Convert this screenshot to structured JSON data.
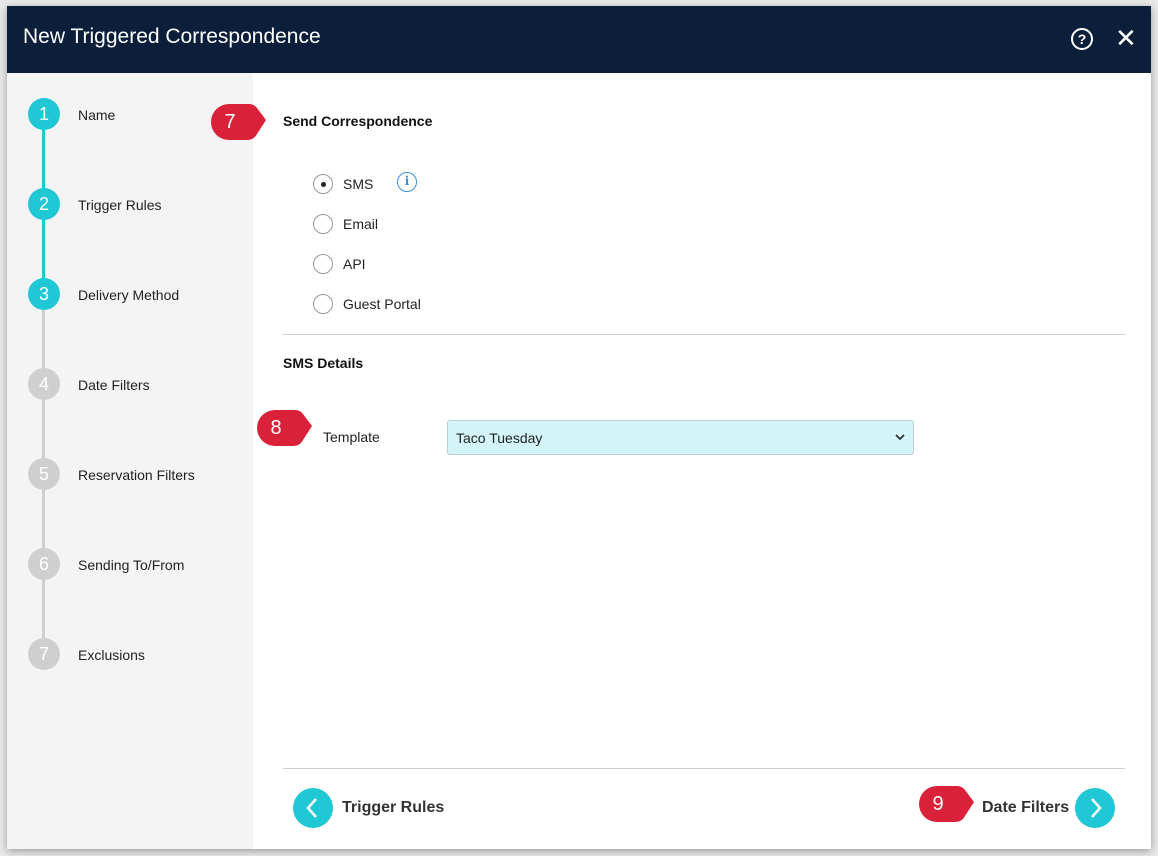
{
  "window": {
    "title": "New Triggered Correspondence",
    "help_icon": "help-circle-icon",
    "close_icon": "close-icon"
  },
  "sidebar": {
    "steps": [
      {
        "number": "1",
        "label": "Name",
        "state": "complete"
      },
      {
        "number": "2",
        "label": "Trigger Rules",
        "state": "complete"
      },
      {
        "number": "3",
        "label": "Delivery Method",
        "state": "current"
      },
      {
        "number": "4",
        "label": "Date Filters",
        "state": "pending"
      },
      {
        "number": "5",
        "label": "Reservation Filters",
        "state": "pending"
      },
      {
        "number": "6",
        "label": "Sending To/From",
        "state": "pending"
      },
      {
        "number": "7",
        "label": "Exclusions",
        "state": "pending"
      }
    ]
  },
  "main": {
    "send_section": {
      "title": "Send Correspondence",
      "options": [
        {
          "label": "SMS",
          "selected": true
        },
        {
          "label": "Email",
          "selected": false
        },
        {
          "label": "API",
          "selected": false
        },
        {
          "label": "Guest Portal",
          "selected": false
        }
      ],
      "info_icon": "info-icon"
    },
    "sms_section": {
      "title": "SMS Details",
      "template_label": "Template",
      "template_value": "Taco Tuesday"
    },
    "footer": {
      "back_label": "Trigger Rules",
      "next_label": "Date Filters"
    }
  },
  "annotations": {
    "markers": [
      "7",
      "8",
      "9"
    ],
    "color": "#d9223a"
  },
  "colors": {
    "header": "#0b1f3b",
    "accent": "#20c7d4",
    "select_bg": "#d3f4f8"
  }
}
